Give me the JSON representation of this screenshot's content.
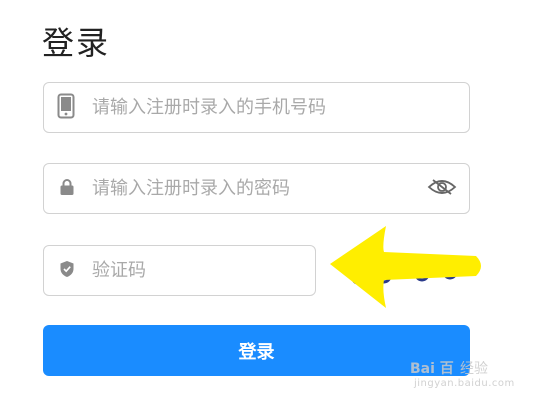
{
  "page": {
    "title": "登录"
  },
  "form": {
    "phone": {
      "placeholder": "请输入注册时录入的手机号码",
      "value": "",
      "icon": "phone-icon"
    },
    "password": {
      "placeholder": "请输入注册时录入的密码",
      "value": "",
      "icon": "lock-icon",
      "toggle_icon": "eye-hidden-icon"
    },
    "captcha": {
      "placeholder": "验证码",
      "value": "",
      "icon": "shield-icon"
    },
    "submit_label": "登录"
  },
  "colors": {
    "primary": "#1a8cff",
    "border": "#d2d2d2",
    "placeholder": "#a9a9a9",
    "annotation_arrow": "#ffee00"
  },
  "watermark": {
    "brand": "Bai 百",
    "product": "经验",
    "url": "jingyan.baidu.com"
  }
}
